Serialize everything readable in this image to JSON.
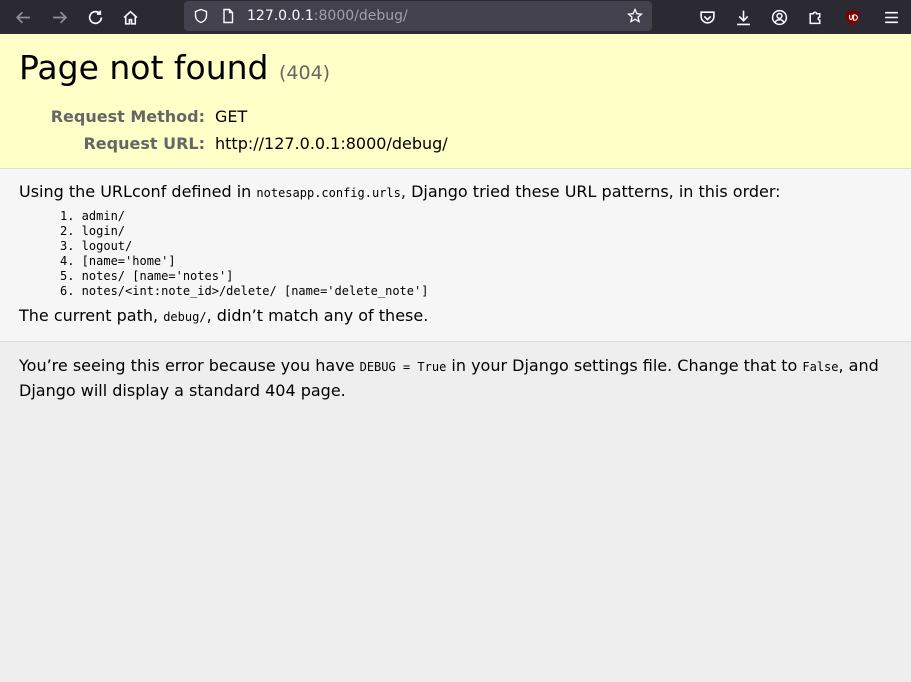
{
  "browser": {
    "url_host": "127.0.0.1",
    "url_rest": ":8000/debug/"
  },
  "summary": {
    "title": "Page not found",
    "status_code": "(404)",
    "request_method_label": "Request Method:",
    "request_method": "GET",
    "request_url_label": "Request URL:",
    "request_url": "http://127.0.0.1:8000/debug/"
  },
  "info": {
    "intro_before": "Using the URLconf defined in ",
    "urlconf": "notesapp.config.urls",
    "intro_after": ", Django tried these URL patterns, in this order:",
    "patterns": [
      "1. admin/",
      "2. login/",
      "3. logout/",
      "4. [name='home']",
      "5. notes/ [name='notes']",
      "6. notes/<int:note_id>/delete/ [name='delete_note']"
    ],
    "current_before": "The current path, ",
    "current_path": "debug/",
    "current_after": ", didn’t match any of these."
  },
  "explanation": {
    "part1": "You’re seeing this error because you have ",
    "debug_code": "DEBUG = True",
    "part2": " in your Django settings file. Change that to ",
    "false_code": "False",
    "part3": ", and Django will display a standard 404 page."
  }
}
